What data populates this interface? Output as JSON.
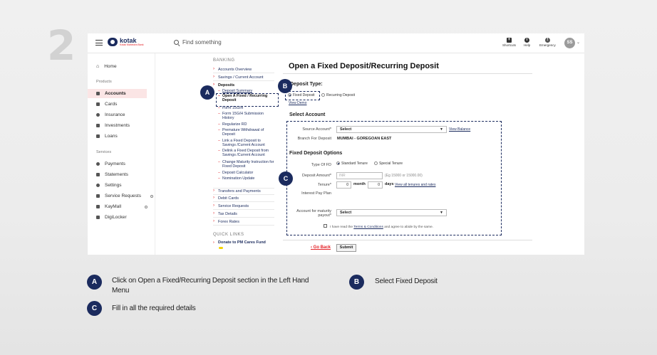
{
  "step_number": "2",
  "header": {
    "logo_name": "kotak",
    "logo_sub": "Kotak Mahindra Bank",
    "search_placeholder": "Find something",
    "tools": [
      {
        "icon": "shortcuts-icon",
        "label": "Shortcuts"
      },
      {
        "icon": "help-icon",
        "label": "Help"
      },
      {
        "icon": "emergency-icon",
        "label": "Emergency"
      }
    ],
    "avatar_initials": "SS"
  },
  "sidebar": {
    "home": "Home",
    "products_label": "Products",
    "products": [
      {
        "label": "Accounts",
        "icon": "bank-icon"
      },
      {
        "label": "Cards",
        "icon": "card-icon"
      },
      {
        "label": "Insurance",
        "icon": "umbrella-icon"
      },
      {
        "label": "Investments",
        "icon": "chart-icon"
      },
      {
        "label": "Loans",
        "icon": "loan-icon"
      }
    ],
    "services_label": "Services",
    "services": [
      {
        "label": "Payments",
        "icon": "payments-icon"
      },
      {
        "label": "Statements",
        "icon": "statements-icon"
      },
      {
        "label": "Settings",
        "icon": "settings-icon"
      },
      {
        "label": "Service Requests",
        "icon": "service-requests-icon"
      },
      {
        "label": "KayMall",
        "icon": "cart-icon"
      },
      {
        "label": "DigiLocker",
        "icon": "digilocker-icon"
      }
    ]
  },
  "banking_menu": {
    "heading": "BANKING",
    "accounts_overview": "Accounts Overview",
    "savings_current": "Savings / Current Account",
    "deposits": "Deposits",
    "deposit_sub": [
      "Deposit Summary",
      "Open A Fixed / Recurring Deposit",
      "Form 15G/H",
      "Form 15G/H Submission History",
      "Regularize RD",
      "Premature Withdrawal of Deposit",
      "Link a Fixed Deposit to Savings /Current Account",
      "Delink a Fixed Deposit from Savings /Current Account",
      "Change Maturity Instruction for Fixed Deposit",
      "Deposit Calculator",
      "Nomination Update"
    ],
    "others": [
      "Transfers and Payments",
      "Debit Cards",
      "Service Requests",
      "Tax Details",
      "Forex Rates"
    ],
    "quick_links_heading": "QUICK LINKS",
    "donate": "Donate to PM Cares Fund"
  },
  "form": {
    "title": "Open a Fixed Deposit/Recurring Deposit",
    "deposit_type_label": "Deposit Type:",
    "fixed_deposit": "Fixed Deposit",
    "recurring_deposit": "Recurring Deposit",
    "view_demo": "View Demo",
    "select_account_heading": "Select Account",
    "source_account_label": "Source Account*",
    "source_account_value": "Select",
    "view_balance": "View Balance",
    "branch_label": "Branch For Deposit",
    "branch_value": "MUMBAI - GOREGOAN EAST",
    "fd_options_heading": "Fixed Deposit Options",
    "type_of_fd_label": "Type Of FD",
    "standard_tenure": "Standard Tenure",
    "special_tenure": "Special Tenure",
    "deposit_amount_label": "Deposit Amount*",
    "deposit_amount_placeholder": "INR",
    "deposit_amount_hint": "(Eg 15000 or 15000.00)",
    "tenure_label": "Tenure*",
    "tenure_month_value": "0",
    "tenure_month_unit": "month",
    "tenure_days_value": "0",
    "tenure_days_unit": "days",
    "view_all_tenures": "View all tenures and rates",
    "interest_pay_plan_label": "Interest Pay Plan",
    "maturity_payout_label": "Account for maturity payout*",
    "maturity_payout_value": "Select",
    "terms_prefix": "I have read the",
    "terms_link": "Terms & Conditions",
    "terms_suffix": "and agree to abide by the same.",
    "go_back": "Go Back",
    "submit": "Submit"
  },
  "legend": [
    {
      "marker": "A",
      "text": "Click on Open a Fixed/Recurring Deposit section in the Left Hand Menu"
    },
    {
      "marker": "B",
      "text": "Select Fixed Deposit"
    },
    {
      "marker": "C",
      "text": "Fill in all the required details"
    }
  ],
  "accent_color": "#1b2b5e",
  "brand_red": "#e31e24"
}
